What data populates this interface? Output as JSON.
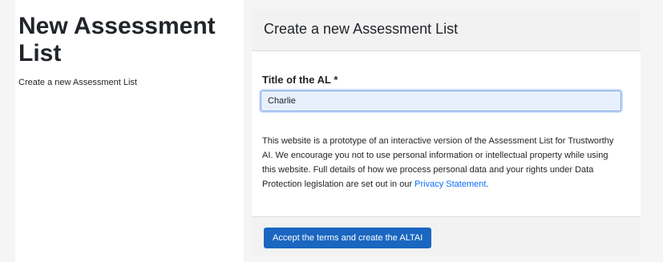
{
  "sidebar": {
    "title": "New Assessment List",
    "subtitle": "Create a new Assessment List"
  },
  "card": {
    "header_title": "Create a new Assessment List",
    "field_label": "Title of the AL *",
    "title_value": "Charlie",
    "notice_text": "This website is a prototype of an interactive version of the Assessment List for Trustworthy AI. We encourage you not to use personal information or intellectual property while using this website. Full details of how we process personal data and your rights under Data Protection legislation are set out in our ",
    "privacy_link": "Privacy Statement",
    "notice_end": ".",
    "accept_button": "Accept the terms and create the ALTAI"
  },
  "colors": {
    "primary": "#1a66c0",
    "link": "#0d6efd",
    "input_bg": "#e8f0fe"
  }
}
